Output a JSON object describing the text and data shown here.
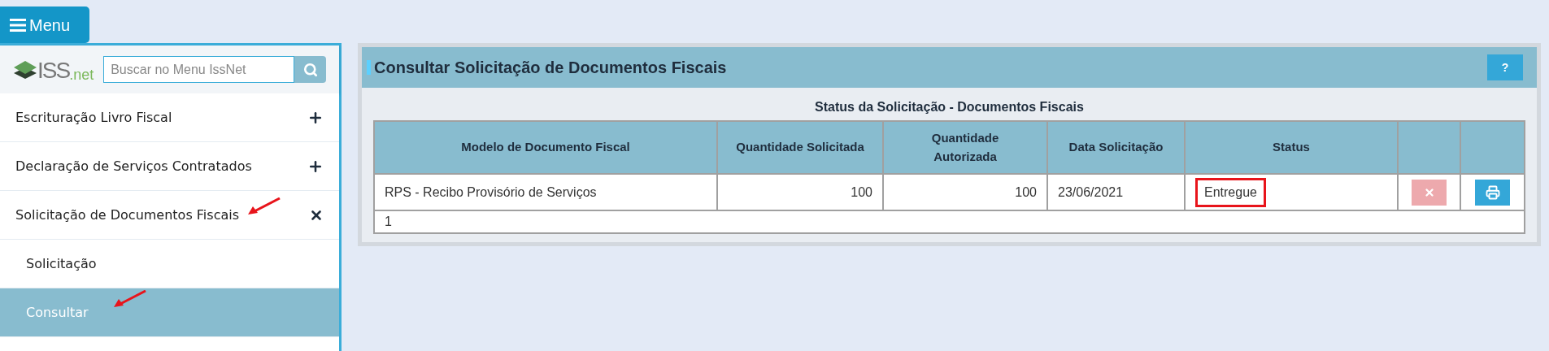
{
  "menu_button": {
    "label": "Menu"
  },
  "sidebar": {
    "logo": {
      "main": "ISS",
      "suffix": ".net"
    },
    "search": {
      "placeholder": "Buscar no Menu IssNet"
    },
    "items": [
      {
        "label": "Escrituração Livro Fiscal",
        "expanded": false,
        "arrow": false
      },
      {
        "label": "Declaração de Serviços Contratados",
        "expanded": false,
        "arrow": false
      },
      {
        "label": "Solicitação de Documentos Fiscais",
        "expanded": true,
        "arrow": true,
        "children": [
          {
            "label": "Solicitação",
            "selected": false,
            "arrow": false
          },
          {
            "label": "Consultar",
            "selected": true,
            "arrow": true
          }
        ]
      }
    ]
  },
  "panel": {
    "title": "Consultar Solicitação de Documentos Fiscais",
    "help_button": "?",
    "table": {
      "caption": "Status da Solicitação - Documentos Fiscais",
      "columns": [
        "Modelo de Documento Fiscal",
        "Quantidade Solicitada",
        "Quantidade Autorizada",
        "Data Solicitação",
        "Status"
      ],
      "rows": [
        {
          "cells": [
            "RPS - Recibo Provisório de Serviços",
            "100",
            "100",
            "23/06/2021",
            "Entregue"
          ],
          "status_highlighted": true,
          "delete_disabled": true
        }
      ],
      "footer": "1"
    }
  }
}
